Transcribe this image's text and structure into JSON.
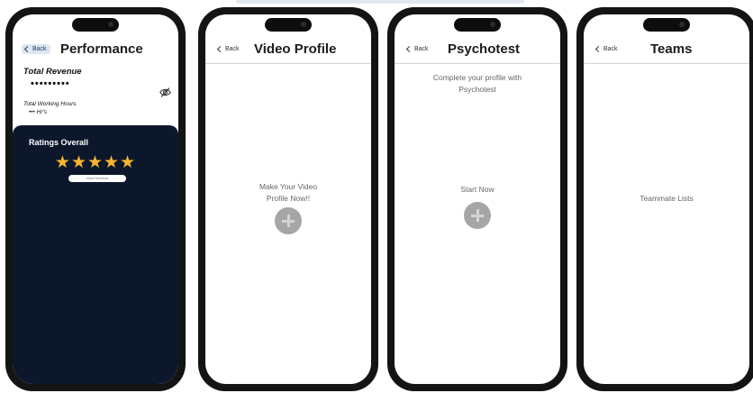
{
  "screens": {
    "performance": {
      "back_label": "Back",
      "title": "Performance",
      "total_revenue_label": "Total Revenue",
      "total_revenue_value": "•••••••••",
      "total_hours_label": "Total Working Hours",
      "total_hours_value": "••• Hr's",
      "ratings_label": "Ratings Overall",
      "rating_stars": 5,
      "rating_glyphs": "★★★★★",
      "view_reviews_label": "View Reviews",
      "eye_icon": "eye-slash-icon"
    },
    "video_profile": {
      "back_label": "Back",
      "title": "Video Profile",
      "prompt_line1": "Make Your Video",
      "prompt_line2": "Profile Now!!",
      "add_icon": "plus-icon"
    },
    "psychotest": {
      "back_label": "Back",
      "title": "Psychotest",
      "intro_line1": "Complete your profile with",
      "intro_line2": "Psychotest",
      "start_label": "Start Now",
      "add_icon": "plus-icon"
    },
    "teams": {
      "back_label": "Back",
      "title": "Teams",
      "list_label": "Teammate Lists"
    }
  },
  "colors": {
    "dark_panel": "#0c172c",
    "star": "#f5b731",
    "plus_button": "#a6a6a6",
    "phone_frame": "#141414"
  }
}
